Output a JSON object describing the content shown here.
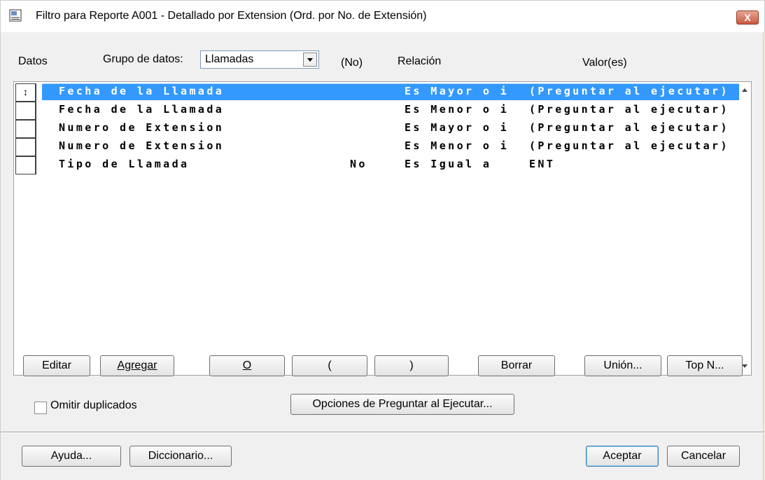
{
  "window": {
    "title": "Filtro para Reporte A001 - Detallado por Extension (Ord. por No. de Extensión)",
    "close_symbol": "X"
  },
  "header": {
    "datos_label": "Datos",
    "grupo_label": "Grupo de datos:",
    "grupo_value": "Llamadas",
    "no_col": "(No)",
    "relacion_col": "Relación",
    "valor_col": "Valor(es)"
  },
  "rows": [
    {
      "field": "Fecha de la Llamada",
      "no": "",
      "relation": "Es Mayor o i",
      "value": "(Preguntar al ejecutar)",
      "marker": "↕"
    },
    {
      "field": "Fecha de la Llamada",
      "no": "",
      "relation": "Es Menor o i",
      "value": "(Preguntar al ejecutar)",
      "marker": ""
    },
    {
      "field": "Numero de Extension",
      "no": "",
      "relation": "Es Mayor o i",
      "value": "(Preguntar al ejecutar)",
      "marker": ""
    },
    {
      "field": "Numero de Extension",
      "no": "",
      "relation": "Es Menor o i",
      "value": "(Preguntar al ejecutar)",
      "marker": ""
    },
    {
      "field": "Tipo de Llamada",
      "no": "No",
      "relation": "Es Igual a",
      "value": "ENT",
      "marker": ""
    }
  ],
  "buttons": {
    "editar": "Editar",
    "agregar": "Agregar",
    "o": "O",
    "open_paren": "(",
    "close_paren": ")",
    "borrar": "Borrar",
    "union": "Unión...",
    "topn": "Top N...",
    "opciones": "Opciones de Preguntar al Ejecutar...",
    "ayuda": "Ayuda...",
    "diccionario": "Diccionario...",
    "aceptar": "Aceptar",
    "cancelar": "Cancelar"
  },
  "omitir": {
    "label": "Omitir duplicados",
    "checked": false
  },
  "colors": {
    "selection": "#3399ff",
    "close": "#c85a3e",
    "background": "#f0f0f0"
  }
}
